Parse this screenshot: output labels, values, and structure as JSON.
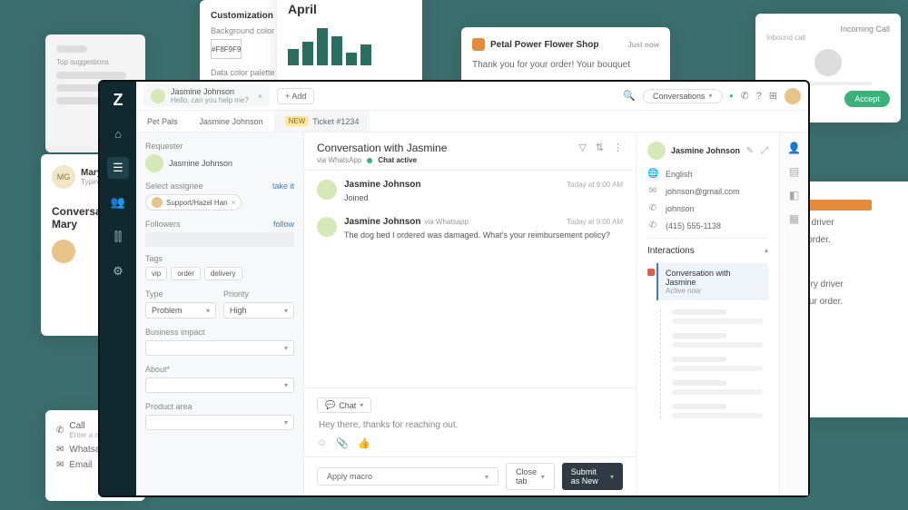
{
  "bg": {
    "card1": {
      "initials": "MG",
      "name": "Mary Gold",
      "status": "Typing ...",
      "title": "Conversation with Mary"
    },
    "card3": {
      "heading": "Customization",
      "label1": "Background color",
      "swatch": "#F8F9F9",
      "label2": "Data color palette"
    },
    "card4": {
      "heading": "April"
    },
    "card5": {
      "shop": "Petal Power Flower Shop",
      "time": "Just now",
      "msg": "Thank you for your order! Your bouquet"
    },
    "card6": {
      "heading": "Incoming Call",
      "sub": "Inbound call",
      "button": "Accept"
    },
    "card7": {
      "line1": "very driver",
      "line2": "our order.",
      "line3": "elivery driver",
      "line4": "e your order."
    },
    "card8": {
      "call": "Call",
      "callsub": "Enter a number",
      "whatsapp": "Whatsapp",
      "email": "Email"
    },
    "card2": {
      "label": "Top suggestions"
    }
  },
  "topbar": {
    "tab_name": "Jasmine Johnson",
    "tab_sub": "Hello, can you help me?",
    "add": "+ Add",
    "conversations": "Conversations"
  },
  "subtabs": {
    "t1": "Pet Pals",
    "t2": "Jasmine Johnson",
    "new": "NEW",
    "t3": "Ticket #1234"
  },
  "left": {
    "requester_label": "Requester",
    "requester_name": "Jasmine Johnson",
    "assignee_label": "Select assignee",
    "assignee_link": "take it",
    "assignee_value": "Support/Hazel Han",
    "followers_label": "Followers",
    "followers_link": "follow",
    "tags_label": "Tags",
    "tags": [
      "vip",
      "order",
      "delivery"
    ],
    "type_label": "Type",
    "type_value": "Problem",
    "priority_label": "Priority",
    "priority_value": "High",
    "impact_label": "Business impact",
    "about_label": "About*",
    "product_label": "Product area"
  },
  "middle": {
    "title": "Conversation with Jasmine",
    "via": "via WhatsApp",
    "chat_active": "Chat active",
    "msg1_name": "Jasmine Johnson",
    "msg1_time": "Today at 9:00 AM",
    "msg1_body": "Joined",
    "msg2_name": "Jasmine Johnson",
    "msg2_via": "via Whatsapp",
    "msg2_time": "Today at 9:00 AM",
    "msg2_body": "The dog bed I ordered was damaged. What's your reimbursement policy?",
    "compose_type": "Chat",
    "compose_text": "Hey there, thanks for reaching out.",
    "macro": "Apply macro",
    "closetab": "Close tab",
    "submit": "Submit as  New"
  },
  "right": {
    "name": "Jasmine Johnson",
    "lang": "English",
    "email": "johnson@gmail.com",
    "handle": "johnson",
    "phone": "(415) 555-1138",
    "interactions": "Interactions",
    "int_title": "Conversation with Jasmine",
    "int_sub": "Active now"
  }
}
